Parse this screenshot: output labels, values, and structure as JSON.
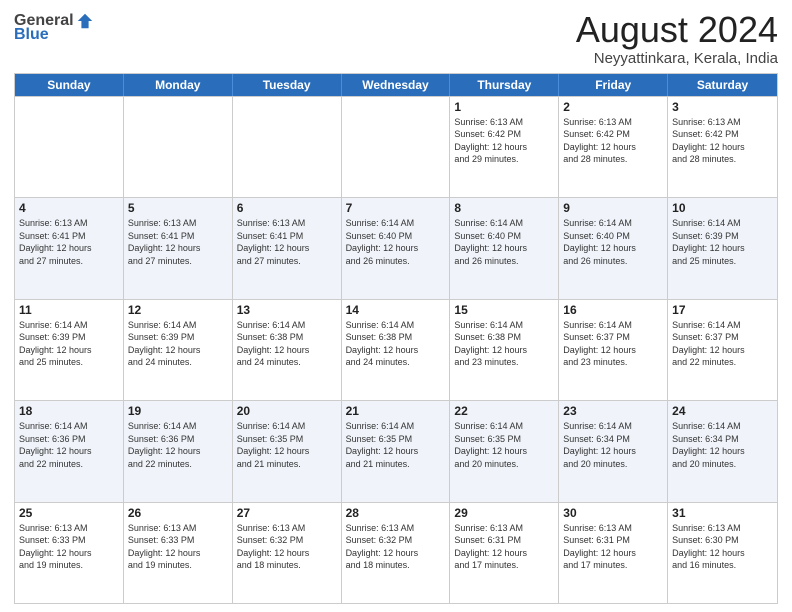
{
  "header": {
    "logo": {
      "general": "General",
      "blue": "Blue"
    },
    "title": "August 2024",
    "location": "Neyyattinkara, Kerala, India"
  },
  "calendar": {
    "days_of_week": [
      "Sunday",
      "Monday",
      "Tuesday",
      "Wednesday",
      "Thursday",
      "Friday",
      "Saturday"
    ],
    "weeks": [
      [
        {
          "day": "",
          "info": ""
        },
        {
          "day": "",
          "info": ""
        },
        {
          "day": "",
          "info": ""
        },
        {
          "day": "",
          "info": ""
        },
        {
          "day": "1",
          "info": "Sunrise: 6:13 AM\nSunset: 6:42 PM\nDaylight: 12 hours\nand 29 minutes."
        },
        {
          "day": "2",
          "info": "Sunrise: 6:13 AM\nSunset: 6:42 PM\nDaylight: 12 hours\nand 28 minutes."
        },
        {
          "day": "3",
          "info": "Sunrise: 6:13 AM\nSunset: 6:42 PM\nDaylight: 12 hours\nand 28 minutes."
        }
      ],
      [
        {
          "day": "4",
          "info": "Sunrise: 6:13 AM\nSunset: 6:41 PM\nDaylight: 12 hours\nand 27 minutes."
        },
        {
          "day": "5",
          "info": "Sunrise: 6:13 AM\nSunset: 6:41 PM\nDaylight: 12 hours\nand 27 minutes."
        },
        {
          "day": "6",
          "info": "Sunrise: 6:13 AM\nSunset: 6:41 PM\nDaylight: 12 hours\nand 27 minutes."
        },
        {
          "day": "7",
          "info": "Sunrise: 6:14 AM\nSunset: 6:40 PM\nDaylight: 12 hours\nand 26 minutes."
        },
        {
          "day": "8",
          "info": "Sunrise: 6:14 AM\nSunset: 6:40 PM\nDaylight: 12 hours\nand 26 minutes."
        },
        {
          "day": "9",
          "info": "Sunrise: 6:14 AM\nSunset: 6:40 PM\nDaylight: 12 hours\nand 26 minutes."
        },
        {
          "day": "10",
          "info": "Sunrise: 6:14 AM\nSunset: 6:39 PM\nDaylight: 12 hours\nand 25 minutes."
        }
      ],
      [
        {
          "day": "11",
          "info": "Sunrise: 6:14 AM\nSunset: 6:39 PM\nDaylight: 12 hours\nand 25 minutes."
        },
        {
          "day": "12",
          "info": "Sunrise: 6:14 AM\nSunset: 6:39 PM\nDaylight: 12 hours\nand 24 minutes."
        },
        {
          "day": "13",
          "info": "Sunrise: 6:14 AM\nSunset: 6:38 PM\nDaylight: 12 hours\nand 24 minutes."
        },
        {
          "day": "14",
          "info": "Sunrise: 6:14 AM\nSunset: 6:38 PM\nDaylight: 12 hours\nand 24 minutes."
        },
        {
          "day": "15",
          "info": "Sunrise: 6:14 AM\nSunset: 6:38 PM\nDaylight: 12 hours\nand 23 minutes."
        },
        {
          "day": "16",
          "info": "Sunrise: 6:14 AM\nSunset: 6:37 PM\nDaylight: 12 hours\nand 23 minutes."
        },
        {
          "day": "17",
          "info": "Sunrise: 6:14 AM\nSunset: 6:37 PM\nDaylight: 12 hours\nand 22 minutes."
        }
      ],
      [
        {
          "day": "18",
          "info": "Sunrise: 6:14 AM\nSunset: 6:36 PM\nDaylight: 12 hours\nand 22 minutes."
        },
        {
          "day": "19",
          "info": "Sunrise: 6:14 AM\nSunset: 6:36 PM\nDaylight: 12 hours\nand 22 minutes."
        },
        {
          "day": "20",
          "info": "Sunrise: 6:14 AM\nSunset: 6:35 PM\nDaylight: 12 hours\nand 21 minutes."
        },
        {
          "day": "21",
          "info": "Sunrise: 6:14 AM\nSunset: 6:35 PM\nDaylight: 12 hours\nand 21 minutes."
        },
        {
          "day": "22",
          "info": "Sunrise: 6:14 AM\nSunset: 6:35 PM\nDaylight: 12 hours\nand 20 minutes."
        },
        {
          "day": "23",
          "info": "Sunrise: 6:14 AM\nSunset: 6:34 PM\nDaylight: 12 hours\nand 20 minutes."
        },
        {
          "day": "24",
          "info": "Sunrise: 6:14 AM\nSunset: 6:34 PM\nDaylight: 12 hours\nand 20 minutes."
        }
      ],
      [
        {
          "day": "25",
          "info": "Sunrise: 6:13 AM\nSunset: 6:33 PM\nDaylight: 12 hours\nand 19 minutes."
        },
        {
          "day": "26",
          "info": "Sunrise: 6:13 AM\nSunset: 6:33 PM\nDaylight: 12 hours\nand 19 minutes."
        },
        {
          "day": "27",
          "info": "Sunrise: 6:13 AM\nSunset: 6:32 PM\nDaylight: 12 hours\nand 18 minutes."
        },
        {
          "day": "28",
          "info": "Sunrise: 6:13 AM\nSunset: 6:32 PM\nDaylight: 12 hours\nand 18 minutes."
        },
        {
          "day": "29",
          "info": "Sunrise: 6:13 AM\nSunset: 6:31 PM\nDaylight: 12 hours\nand 17 minutes."
        },
        {
          "day": "30",
          "info": "Sunrise: 6:13 AM\nSunset: 6:31 PM\nDaylight: 12 hours\nand 17 minutes."
        },
        {
          "day": "31",
          "info": "Sunrise: 6:13 AM\nSunset: 6:30 PM\nDaylight: 12 hours\nand 16 minutes."
        }
      ]
    ]
  }
}
